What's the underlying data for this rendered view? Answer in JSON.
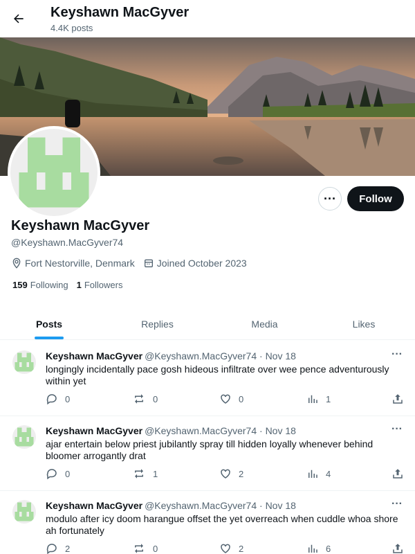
{
  "header": {
    "name": "Keyshawn MacGyver",
    "posts_count": "4.4K posts"
  },
  "profile": {
    "name": "Keyshawn MacGyver",
    "handle": "@Keyshawn.MacGyver74",
    "location": "Fort Nestorville, Denmark",
    "joined": "Joined October 2023",
    "following_count": "159",
    "following_label": "Following",
    "followers_count": "1",
    "followers_label": "Followers",
    "follow_button": "Follow",
    "more_button": "···",
    "avatar_color": "#a8dca0"
  },
  "tabs": [
    {
      "label": "Posts",
      "active": true
    },
    {
      "label": "Replies",
      "active": false
    },
    {
      "label": "Media",
      "active": false
    },
    {
      "label": "Likes",
      "active": false
    }
  ],
  "posts": [
    {
      "author": "Keyshawn MacGyver",
      "meta": "@Keyshawn.MacGyver74 · Nov 18",
      "text": "longingly incidentally pace gosh hideous infiltrate over wee pence adventurously within yet",
      "replies": "0",
      "reposts": "0",
      "likes": "0",
      "views": "1"
    },
    {
      "author": "Keyshawn MacGyver",
      "meta": "@Keyshawn.MacGyver74 · Nov 18",
      "text": "ajar entertain below priest jubilantly spray till hidden loyally whenever behind bloomer arrogantly drat",
      "replies": "0",
      "reposts": "1",
      "likes": "2",
      "views": "4"
    },
    {
      "author": "Keyshawn MacGyver",
      "meta": "@Keyshawn.MacGyver74 · Nov 18",
      "text": "modulo after icy doom harangue offset the yet overreach when cuddle whoa shore ah fortunately",
      "replies": "2",
      "reposts": "0",
      "likes": "2",
      "views": "6"
    }
  ],
  "icons": {
    "back": "arrow-left-icon",
    "location": "location-pin-icon",
    "calendar": "calendar-icon",
    "reply": "reply-icon",
    "repost": "repost-icon",
    "like": "heart-icon",
    "views": "views-icon",
    "share": "share-icon"
  },
  "colors": {
    "accent": "#1d9bf0",
    "text": "#0f1419",
    "secondary": "#536471",
    "follow_bg": "#0f1419"
  }
}
